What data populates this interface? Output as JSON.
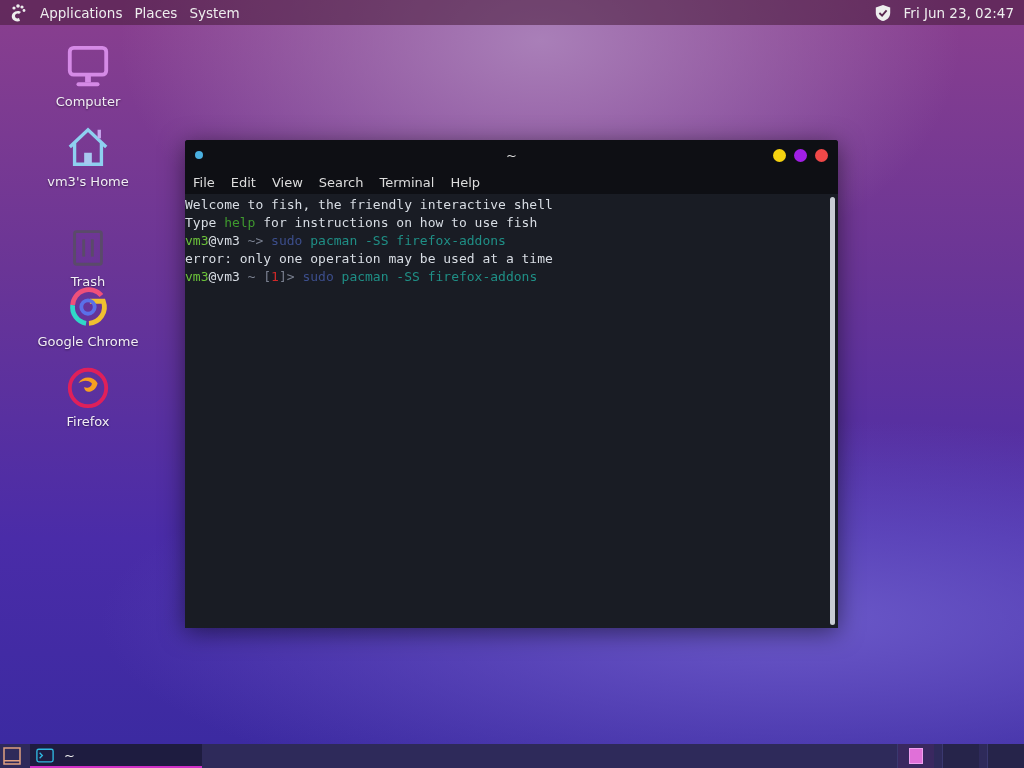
{
  "top_panel": {
    "menus": [
      {
        "label": "Applications"
      },
      {
        "label": "Places"
      },
      {
        "label": "System"
      }
    ],
    "clock": "Fri Jun 23, 02:47"
  },
  "desktop_icons": [
    {
      "kind": "computer",
      "label": "Computer"
    },
    {
      "kind": "home",
      "label": "vm3's Home"
    },
    {
      "kind": "trash",
      "label": "Trash"
    },
    {
      "kind": "chrome",
      "label": "Google Chrome"
    },
    {
      "kind": "firefox",
      "label": "Firefox"
    }
  ],
  "terminal": {
    "title": "~",
    "window_buttons": [
      {
        "color": "#f5d210"
      },
      {
        "color": "#a21fe6"
      },
      {
        "color": "#f04848"
      }
    ],
    "menu": [
      "File",
      "Edit",
      "View",
      "Search",
      "Terminal",
      "Help"
    ],
    "lines": [
      [
        {
          "kind": "text",
          "text": "Welcome to fish, the friendly interactive shell"
        }
      ],
      [
        {
          "kind": "text",
          "text": "Type "
        },
        {
          "kind": "help",
          "text": "help"
        },
        {
          "kind": "text",
          "text": " for instructions on how to use fish"
        }
      ],
      [
        {
          "kind": "user",
          "text": "vm3"
        },
        {
          "kind": "text",
          "text": "@vm3"
        },
        {
          "kind": "dim",
          "text": " ~> "
        },
        {
          "kind": "sudo",
          "text": "sudo"
        },
        {
          "kind": "cmd",
          "text": " pacman -SS firefox-addons"
        }
      ],
      [
        {
          "kind": "text",
          "text": "error: only one operation may be used at a time"
        }
      ],
      [
        {
          "kind": "user",
          "text": "vm3"
        },
        {
          "kind": "text",
          "text": "@vm3"
        },
        {
          "kind": "dim",
          "text": " ~ ["
        },
        {
          "kind": "status",
          "text": "1"
        },
        {
          "kind": "dim",
          "text": "]> "
        },
        {
          "kind": "sudo",
          "text": "sudo"
        },
        {
          "kind": "cmd",
          "text": " pacman -SS firefox-addons"
        }
      ]
    ]
  },
  "taskbar": {
    "tasks": [
      {
        "label": "~",
        "selected": true
      }
    ],
    "workspaces": [
      {
        "selected": true
      },
      {
        "selected": false
      },
      {
        "selected": false
      }
    ]
  }
}
